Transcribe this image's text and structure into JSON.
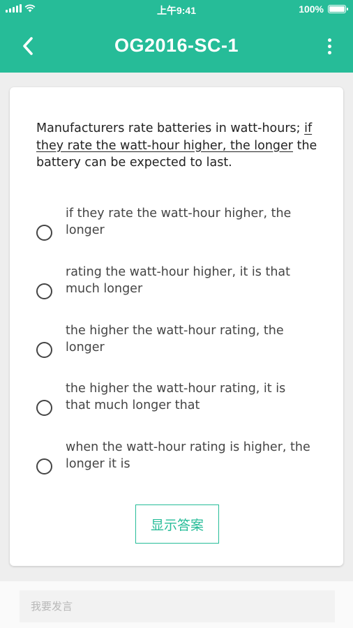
{
  "status_bar": {
    "time": "上午9:41",
    "battery": "100%",
    "battery_level": 1.0
  },
  "header": {
    "title": "OG2016-SC-1",
    "back_icon": "chevron-left-icon",
    "more_icon": "more-vertical-icon"
  },
  "question": {
    "text_before": "Manufacturers rate batteries in watt-hours; ",
    "underlined": "if they rate the watt-hour higher, the longer",
    "text_after": " the battery can be expected to last."
  },
  "options": [
    {
      "label": "if they rate the watt-hour higher, the longer"
    },
    {
      "label": "rating the watt-hour higher, it is that much longer"
    },
    {
      "label": "the higher the watt-hour rating, the longer"
    },
    {
      "label": "the higher the watt-hour rating, it is that much longer that"
    },
    {
      "label": "when the watt-hour rating is higher, the longer it is"
    }
  ],
  "show_answer_label": "显示答案",
  "comment": {
    "placeholder": "我要发言"
  },
  "colors": {
    "accent": "#26bc98"
  }
}
